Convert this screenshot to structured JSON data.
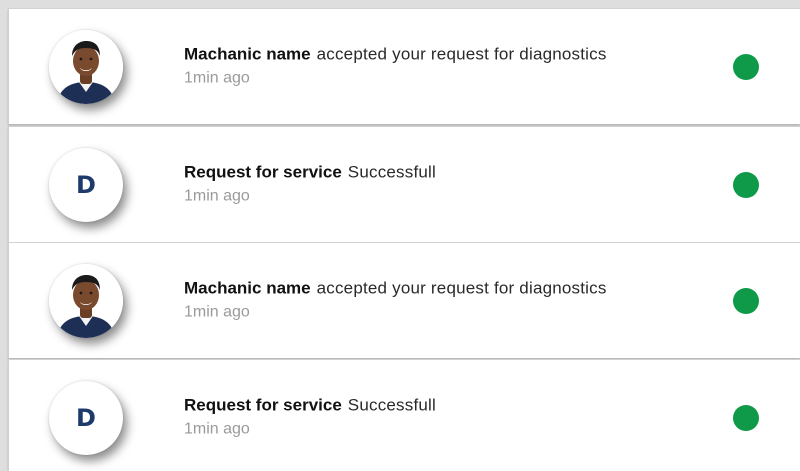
{
  "notifications": [
    {
      "avatar_type": "photo",
      "avatar_icon": "user-photo",
      "title": "Machanic name",
      "message": "accepted your request for diagnostics",
      "time": "1min ago",
      "status_color": "#0e9a48"
    },
    {
      "avatar_type": "letter",
      "avatar_letter": "D",
      "title": "Request for service",
      "message": "Successfull",
      "time": "1min ago",
      "status_color": "#0e9a48"
    },
    {
      "avatar_type": "photo",
      "avatar_icon": "user-photo",
      "title": "Machanic name",
      "message": "accepted your request for diagnostics",
      "time": "1min ago",
      "status_color": "#0e9a48"
    },
    {
      "avatar_type": "letter",
      "avatar_letter": "D",
      "title": "Request for service",
      "message": "Successfull",
      "time": "1min ago",
      "status_color": "#0e9a48"
    }
  ]
}
